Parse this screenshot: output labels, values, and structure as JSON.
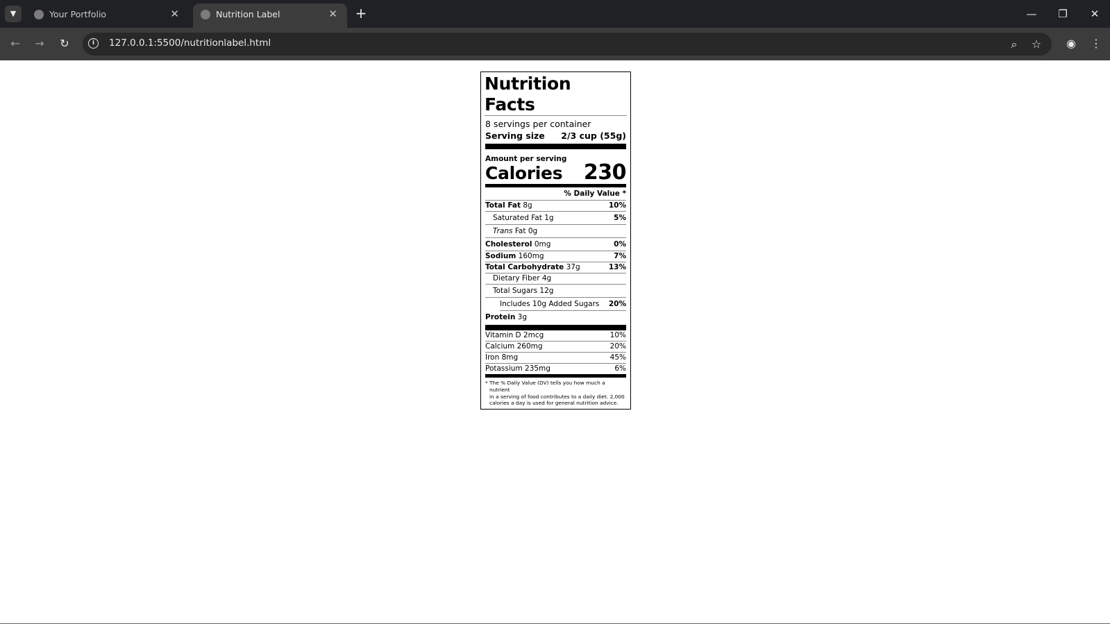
{
  "browser": {
    "tabs": [
      {
        "title": "Your Portfolio",
        "active": false
      },
      {
        "title": "Nutrition Label",
        "active": true
      }
    ],
    "url": "127.0.0.1:5500/nutritionlabel.html",
    "icons": {
      "tab_menu": "chevron-down-icon",
      "new_tab": "plus-icon",
      "back": "arrow-left-icon",
      "forward": "arrow-right-icon",
      "reload": "reload-icon",
      "site_info": "info-icon",
      "zoom": "zoom-icon",
      "bookmark": "star-icon",
      "profile": "profile-icon",
      "menu": "kebab-menu-icon"
    }
  },
  "label": {
    "title": "Nutrition Facts",
    "servings_per_container": "8 servings per container",
    "serving_size_label": "Serving size",
    "serving_size_value": "2/3 cup (55g)",
    "amount_per_serving": "Amount per serving",
    "calories_label": "Calories",
    "calories_value": "230",
    "daily_value_header": "% Daily Value *",
    "nutrients": [
      {
        "name": "Total Fat",
        "amount": "8g",
        "dv": "10%"
      },
      {
        "name": "Saturated Fat",
        "amount": "1g",
        "dv": "5%"
      },
      {
        "name": "Trans",
        "name_suffix": "Fat",
        "amount": "0g",
        "dv": ""
      },
      {
        "name": "Cholesterol",
        "amount": "0mg",
        "dv": "0%"
      },
      {
        "name": "Sodium",
        "amount": "160mg",
        "dv": "7%"
      },
      {
        "name": "Total Carbohydrate",
        "amount": "37g",
        "dv": "13%"
      },
      {
        "name": "Dietary Fiber",
        "amount": "4g",
        "dv": ""
      },
      {
        "name": "Total Sugars",
        "amount": "12g",
        "dv": ""
      },
      {
        "name": "Includes 10g Added Sugars",
        "amount": "",
        "dv": "20%"
      },
      {
        "name": "Protein",
        "amount": "3g",
        "dv": ""
      }
    ],
    "vitamins": [
      {
        "name": "Vitamin D 2mcg",
        "dv": "10%"
      },
      {
        "name": "Calcium 260mg",
        "dv": "20%"
      },
      {
        "name": "Iron 8mg",
        "dv": "45%"
      },
      {
        "name": "Potassium 235mg",
        "dv": "6%"
      }
    ],
    "footnote_star": "*",
    "footnote_lines": [
      "The % Daily Value (DV) tells you how much a nutrient",
      "in a serving of food contributes to a daily diet. 2,000",
      "calories a day is used for general nutrition advice."
    ]
  }
}
